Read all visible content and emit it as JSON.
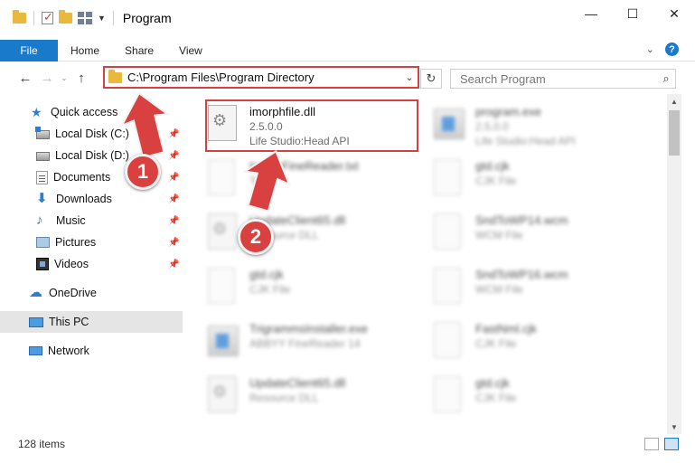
{
  "window": {
    "title": "Program",
    "controls": {
      "minimize": "—",
      "maximize": "☐",
      "close": "✕"
    }
  },
  "ribbon": {
    "tabs": [
      "File",
      "Home",
      "Share",
      "View"
    ],
    "collapse_icon": "chevron-down-icon",
    "help_label": "?"
  },
  "nav": {
    "back": "←",
    "forward": "→",
    "recent": "⌄",
    "up": "↑",
    "address": "C:\\Program Files\\Program Directory",
    "address_dropdown": "⌄",
    "refresh": "↻",
    "search_placeholder": "Search Program",
    "search_icon": "⌕"
  },
  "sidebar": {
    "items": [
      {
        "label": "Quick access",
        "icon": "star-icon",
        "pinned": false
      },
      {
        "label": "Local Disk (C:)",
        "icon": "drive-c-icon",
        "pinned": true
      },
      {
        "label": "Local Disk (D:)",
        "icon": "drive-d-icon",
        "pinned": true
      },
      {
        "label": "Documents",
        "icon": "documents-icon",
        "pinned": true
      },
      {
        "label": "Downloads",
        "icon": "downloads-icon",
        "pinned": true
      },
      {
        "label": "Music",
        "icon": "music-icon",
        "pinned": true
      },
      {
        "label": "Pictures",
        "icon": "pictures-icon",
        "pinned": true
      },
      {
        "label": "Videos",
        "icon": "videos-icon",
        "pinned": true
      },
      {
        "label": "OneDrive",
        "icon": "onedrive-icon",
        "pinned": false
      },
      {
        "label": "This PC",
        "icon": "this-pc-icon",
        "pinned": false,
        "selected": true
      },
      {
        "label": "Network",
        "icon": "network-icon",
        "pinned": false
      }
    ],
    "pin_glyph": "📌"
  },
  "files": [
    {
      "name": "imorphfile.dll",
      "line2": "2.5.0.0",
      "line3": "Life Studio:Head API",
      "icon": "dll-icon"
    },
    {
      "name": "program.exe",
      "line2": "2.5.0.0",
      "line3": "Life Studio:Head API",
      "icon": "exe-icon"
    },
    {
      "name": "ImageFineReader.txt",
      "line2": "Text",
      "line3": "",
      "icon": "text-file-icon"
    },
    {
      "name": "gtd.cjk",
      "line2": "CJK File",
      "line3": "",
      "icon": "file-icon"
    },
    {
      "name": "UpdateClient65.dll",
      "line2": "Resource DLL",
      "line3": "",
      "icon": "dll-icon"
    },
    {
      "name": "SndToWP14.wcm",
      "line2": "WCM File",
      "line3": "",
      "icon": "file-icon"
    },
    {
      "name": "gtd.cjk",
      "line2": "CJK File",
      "line3": "",
      "icon": "file-icon"
    },
    {
      "name": "SndToWP16.wcm",
      "line2": "WCM File",
      "line3": "",
      "icon": "file-icon"
    },
    {
      "name": "TrigrammsInstaller.exe",
      "line2": "ABBYY FineReader 14",
      "line3": "",
      "icon": "installer-icon"
    },
    {
      "name": "FastNml.cjk",
      "line2": "CJK File",
      "line3": "",
      "icon": "file-icon"
    },
    {
      "name": "UpdateClient65.dll",
      "line2": "Resource DLL",
      "line3": "",
      "icon": "dll-icon"
    },
    {
      "name": "gtd.cjk",
      "line2": "CJK File",
      "line3": "",
      "icon": "file-icon"
    }
  ],
  "status": {
    "item_count": "128 items"
  },
  "annotations": {
    "step1": "1",
    "step2": "2",
    "color": "#d8413f"
  },
  "colors": {
    "accent": "#1979ca",
    "highlight": "#d84040",
    "folder": "#e8b93c"
  }
}
